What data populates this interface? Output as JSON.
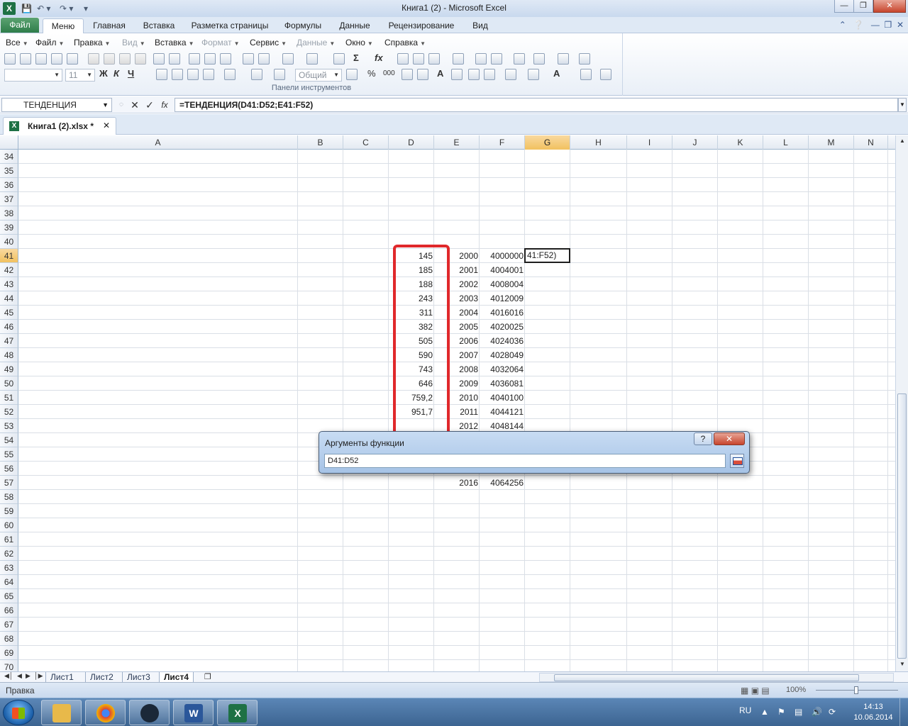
{
  "window": {
    "title": "Книга1 (2)  -  Microsoft Excel",
    "quick_access": [
      "save-icon",
      "undo-icon",
      "redo-icon",
      "customize-icon"
    ],
    "buttons": [
      "minimize",
      "restore",
      "close"
    ]
  },
  "ribbon_tabs": {
    "file": "Файл",
    "items": [
      "Меню",
      "Главная",
      "Вставка",
      "Разметка страницы",
      "Формулы",
      "Данные",
      "Рецензирование",
      "Вид"
    ],
    "active": "Меню"
  },
  "menu_bar": {
    "items": [
      {
        "label": "Все",
        "enabled": true
      },
      {
        "label": "Файл",
        "enabled": true
      },
      {
        "label": "Правка",
        "enabled": true
      },
      {
        "label": "Вид",
        "enabled": false
      },
      {
        "label": "Вставка",
        "enabled": true
      },
      {
        "label": "Формат",
        "enabled": false
      },
      {
        "label": "Данные",
        "enabled": false
      },
      {
        "label": "Сервис",
        "enabled": true
      },
      {
        "label": "Окно",
        "enabled": true
      },
      {
        "label": "Справка",
        "enabled": true
      }
    ],
    "font_size": "11",
    "number_format": "Общий",
    "bold": "Ж",
    "italic": "К",
    "underline": "Ч",
    "group_label": "Панели инструментов"
  },
  "formula_bar": {
    "name_box": "ТЕНДЕНЦИЯ",
    "cancel": "✕",
    "enter": "✓",
    "fx": "fx",
    "formula": "=ТЕНДЕНЦИЯ(D41:D52;E41:F52)"
  },
  "workbook_tab": {
    "label": "Книга1 (2).xlsx  *",
    "close": "✕"
  },
  "grid": {
    "columns": [
      "A",
      "B",
      "C",
      "D",
      "E",
      "F",
      "G",
      "H",
      "I",
      "J",
      "K",
      "L",
      "M",
      "N"
    ],
    "selected_column": "G",
    "rows": [
      34,
      35,
      36,
      37,
      38,
      39,
      40,
      41,
      42,
      43,
      44,
      45,
      46,
      47,
      48,
      49,
      50,
      51,
      52,
      53,
      54,
      55,
      56,
      57,
      58,
      59,
      60,
      61,
      62,
      63,
      64,
      65,
      66,
      67,
      68,
      69,
      70
    ],
    "selected_row": 41,
    "active_cell_text": "41:F52)",
    "data_rows": [
      {
        "row": 41,
        "D": "145",
        "E": "2000",
        "F": "4000000"
      },
      {
        "row": 42,
        "D": "185",
        "E": "2001",
        "F": "4004001"
      },
      {
        "row": 43,
        "D": "188",
        "E": "2002",
        "F": "4008004"
      },
      {
        "row": 44,
        "D": "243",
        "E": "2003",
        "F": "4012009"
      },
      {
        "row": 45,
        "D": "311",
        "E": "2004",
        "F": "4016016"
      },
      {
        "row": 46,
        "D": "382",
        "E": "2005",
        "F": "4020025"
      },
      {
        "row": 47,
        "D": "505",
        "E": "2006",
        "F": "4024036"
      },
      {
        "row": 48,
        "D": "590",
        "E": "2007",
        "F": "4028049"
      },
      {
        "row": 49,
        "D": "743",
        "E": "2008",
        "F": "4032064"
      },
      {
        "row": 50,
        "D": "646",
        "E": "2009",
        "F": "4036081"
      },
      {
        "row": 51,
        "D": "759,2",
        "E": "2010",
        "F": "4040100"
      },
      {
        "row": 52,
        "D": "951,7",
        "E": "2011",
        "F": "4044121"
      },
      {
        "row": 53,
        "D": "",
        "E": "2012",
        "F": "4048144"
      },
      {
        "row": 57,
        "D": "",
        "E": "2016",
        "F": "4064256"
      }
    ],
    "highlight_color": "#e0282b"
  },
  "dialog": {
    "title": "Аргументы функции",
    "help": "?",
    "close": "✕",
    "input_value": "D41:D52"
  },
  "sheet_tabs": {
    "items": [
      "Лист1",
      "Лист2",
      "Лист3",
      "Лист4"
    ],
    "active": "Лист4"
  },
  "status_bar": {
    "status": "Правка",
    "zoom": "100%"
  },
  "taskbar": {
    "apps": [
      "explorer",
      "chrome",
      "steam",
      "word",
      "excel"
    ],
    "language": "RU",
    "time": "14:13",
    "date": "10.06.2014"
  }
}
